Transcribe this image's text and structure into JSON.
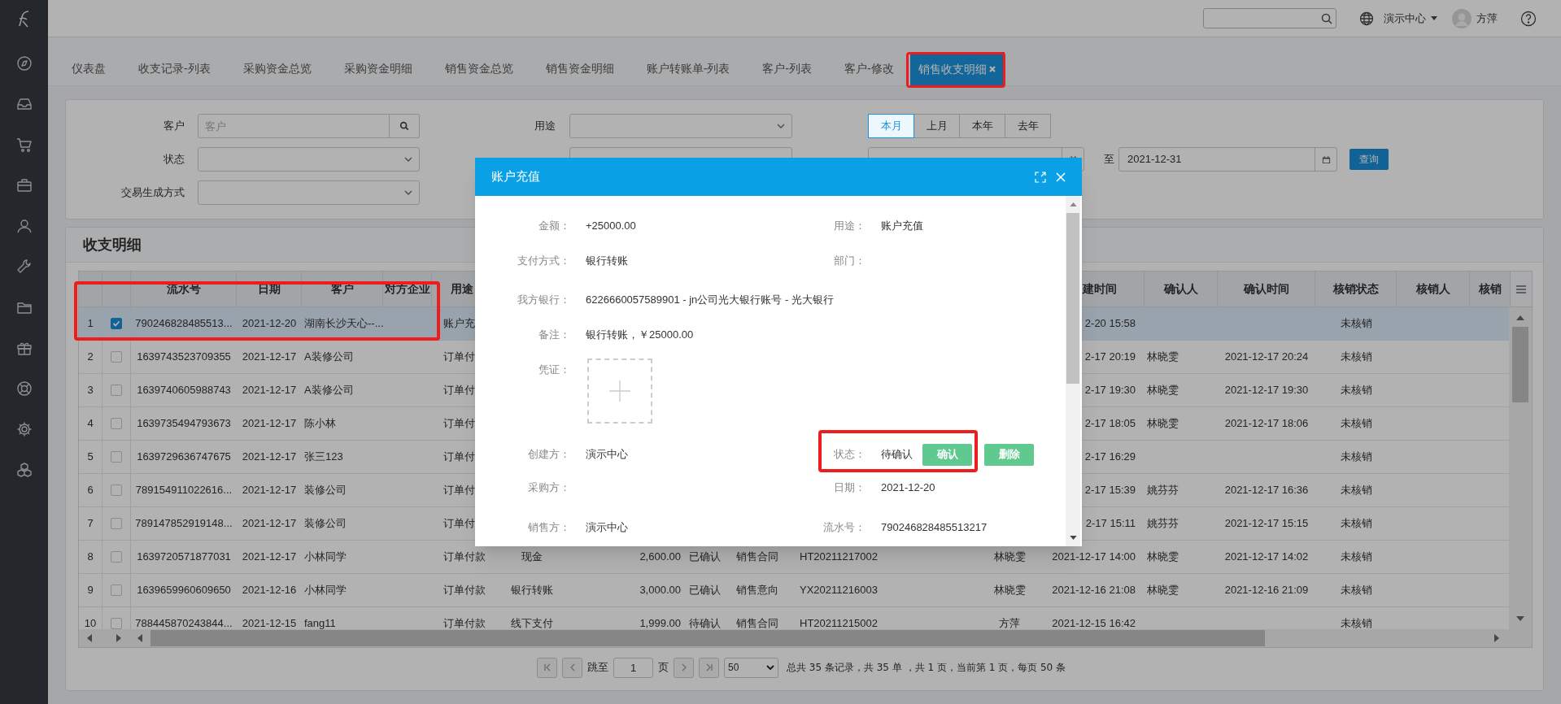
{
  "top_bar": {
    "org": "演示中心",
    "user": "方萍"
  },
  "tabs": [
    {
      "label": "仪表盘",
      "selected": false
    },
    {
      "label": "收支记录-列表",
      "selected": false
    },
    {
      "label": "采购资金总览",
      "selected": false
    },
    {
      "label": "采购资金明细",
      "selected": false
    },
    {
      "label": "销售资金总览",
      "selected": false
    },
    {
      "label": "销售资金明细",
      "selected": false
    },
    {
      "label": "账户转账单-列表",
      "selected": false
    },
    {
      "label": "客户-列表",
      "selected": false
    },
    {
      "label": "客户-修改",
      "selected": false
    },
    {
      "label": "销售收支明细",
      "selected": true
    }
  ],
  "filters": {
    "customer": {
      "label": "客户",
      "placeholder": "客户"
    },
    "purpose": {
      "label": "用途"
    },
    "status": {
      "label": "状态"
    },
    "method": {
      "label": "交易生成方式"
    },
    "periods": [
      {
        "label": "本月",
        "selected": true
      },
      {
        "label": "上月",
        "selected": false
      },
      {
        "label": "本年",
        "selected": false
      },
      {
        "label": "去年",
        "selected": false
      }
    ],
    "to_label": "至",
    "date_to": "2021-12-31",
    "query_button": "查询"
  },
  "section_title": "收支明细",
  "table": {
    "columns": [
      "流水号",
      "日期",
      "客户",
      "对方企业",
      "用途",
      null,
      null,
      null,
      null,
      null,
      null,
      null,
      "建时间",
      "确认人",
      "确认时间",
      "核销状态",
      "核销人",
      "核销"
    ],
    "rows": [
      {
        "no": "1",
        "checked": true,
        "selected": true,
        "cells": [
          "790246828485513...",
          "2021-12-20",
          "湖南长沙天心--...",
          null,
          "账户充",
          null,
          null,
          null,
          null,
          null,
          null,
          null,
          "2-20 15:58",
          null,
          null,
          "未核销",
          null,
          null
        ]
      },
      {
        "no": "2",
        "checked": false,
        "selected": false,
        "cells": [
          "1639743523709355",
          "2021-12-17",
          "A装修公司",
          null,
          "订单付",
          null,
          null,
          null,
          null,
          null,
          null,
          null,
          "2-17 20:19",
          "林晓雯",
          "2021-12-17 20:24",
          "未核销",
          null,
          null
        ]
      },
      {
        "no": "3",
        "checked": false,
        "selected": false,
        "cells": [
          "1639740605988743",
          "2021-12-17",
          "A装修公司",
          null,
          "订单付",
          null,
          null,
          null,
          null,
          null,
          null,
          null,
          "2-17 19:30",
          "林晓雯",
          "2021-12-17 19:30",
          "未核销",
          null,
          null
        ]
      },
      {
        "no": "4",
        "checked": false,
        "selected": false,
        "cells": [
          "1639735494793673",
          "2021-12-17",
          "陈小林",
          null,
          "订单付",
          null,
          null,
          null,
          null,
          null,
          null,
          null,
          "2-17 18:05",
          "林晓雯",
          "2021-12-17 18:06",
          "未核销",
          null,
          null
        ]
      },
      {
        "no": "5",
        "checked": false,
        "selected": false,
        "cells": [
          "1639729636747675",
          "2021-12-17",
          "张三123",
          null,
          "订单付",
          null,
          null,
          null,
          null,
          null,
          null,
          null,
          "2-17 16:29",
          null,
          null,
          "未核销",
          null,
          null
        ]
      },
      {
        "no": "6",
        "checked": false,
        "selected": false,
        "cells": [
          "789154911022616...",
          "2021-12-17",
          "装修公司",
          null,
          "订单付",
          null,
          null,
          null,
          null,
          null,
          null,
          null,
          "2-17 15:39",
          "姚芬芬",
          "2021-12-17 16:36",
          "未核销",
          null,
          null
        ]
      },
      {
        "no": "7",
        "checked": false,
        "selected": false,
        "cells": [
          "789147852919148...",
          "2021-12-17",
          "装修公司",
          null,
          "订单付",
          null,
          null,
          null,
          null,
          null,
          null,
          null,
          "2-17 15:11",
          "姚芬芬",
          "2021-12-17 15:15",
          "未核销",
          null,
          null
        ]
      },
      {
        "no": "8",
        "checked": false,
        "selected": false,
        "cells": [
          "1639720571877031",
          "2021-12-17",
          "小林同学",
          null,
          "订单付款",
          "现金",
          "2,600.00",
          "已确认",
          "销售合同",
          "HT20211217002",
          null,
          "林晓雯",
          "2021-12-17 14:00",
          "林晓雯",
          "2021-12-17 14:02",
          "未核销",
          null,
          null
        ]
      },
      {
        "no": "9",
        "checked": false,
        "selected": false,
        "cells": [
          "1639659960609650",
          "2021-12-16",
          "小林同学",
          null,
          "订单付款",
          "银行转账",
          "3,000.00",
          "已确认",
          "销售意向",
          "YX20211216003",
          null,
          "林晓雯",
          "2021-12-16 21:08",
          "林晓雯",
          "2021-12-16 21:09",
          "未核销",
          null,
          null
        ]
      },
      {
        "no": "10",
        "checked": false,
        "selected": false,
        "cells": [
          "788445870243844...",
          "2021-12-15",
          "fang11",
          null,
          "订单付款",
          "线下支付",
          "1,999.00",
          "待确认",
          "销售合同",
          "HT20211215002",
          null,
          "方萍",
          "2021-12-15 16:42",
          null,
          null,
          "未核销",
          null,
          null
        ]
      }
    ]
  },
  "pagination": {
    "jump_label": "跳至",
    "page": "1",
    "page_unit": "页",
    "page_size": "50",
    "summary": "总共 35 条记录，共 35 单 ，共 1 页，当前第 1 页，每页 50 条"
  },
  "dialog": {
    "title": "账户充值",
    "rows": [
      {
        "kind": "pair",
        "left": {
          "label": "金额：",
          "value": "+25000.00"
        },
        "right": {
          "label": "用途：",
          "value": "账户充值"
        }
      },
      {
        "kind": "pair",
        "left": {
          "label": "支付方式：",
          "value": "银行转账"
        },
        "right": {
          "label": "部门："
        }
      },
      {
        "kind": "wide",
        "left": {
          "label": "我方银行：",
          "value": "6226660057589901 - jn公司光大银行账号 - 光大银行"
        }
      },
      {
        "kind": "pair",
        "left": {
          "label": "备注：",
          "value": "银行转账，￥25000.00"
        }
      },
      {
        "kind": "upload",
        "left": {
          "label": "凭证："
        }
      },
      {
        "kind": "pair",
        "left": {
          "label": "创建方：",
          "value": "演示中心"
        },
        "right": {
          "label": "状态：",
          "value": "待确认",
          "actions": [
            "确认",
            "删除"
          ]
        }
      },
      {
        "kind": "pair",
        "left": {
          "label": "采购方："
        },
        "right": {
          "label": "日期：",
          "value": "2021-12-20"
        }
      },
      {
        "kind": "pair",
        "left": {
          "label": "销售方：",
          "value": "演示中心"
        },
        "right": {
          "label": "流水号：",
          "value": "790246828485513217"
        }
      }
    ]
  }
}
